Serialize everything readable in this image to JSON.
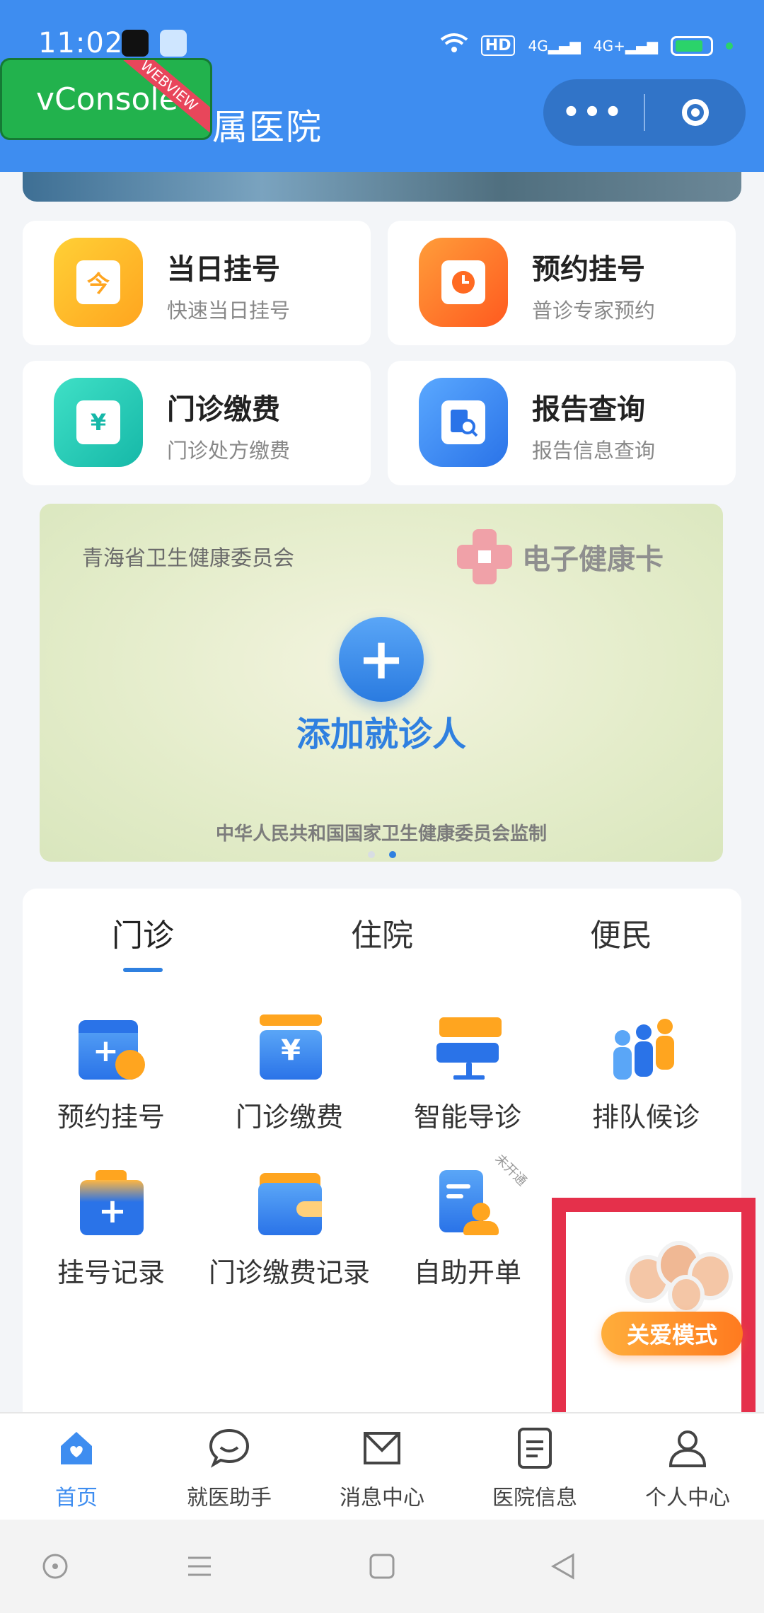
{
  "status_bar": {
    "time": "11:02",
    "net1": "4G",
    "net2": "4G+",
    "hd": "HD"
  },
  "vconsole": {
    "label": "vConsole",
    "ribbon": "WEBVIEW"
  },
  "header": {
    "title": "属医院"
  },
  "quick": [
    {
      "title": "当日挂号",
      "subtitle": "快速当日挂号",
      "icon_text": "今"
    },
    {
      "title": "预约挂号",
      "subtitle": "普诊专家预约"
    },
    {
      "title": "门诊缴费",
      "subtitle": "门诊处方缴费",
      "icon_text": "¥"
    },
    {
      "title": "报告查询",
      "subtitle": "报告信息查询"
    }
  ],
  "health_card": {
    "org": "青海省卫生健康委员会",
    "brand": "电子健康卡",
    "add_label": "添加就诊人",
    "footer": "中华人民共和国国家卫生健康委员会监制"
  },
  "tabs": [
    "门诊",
    "住院",
    "便民"
  ],
  "services": [
    {
      "label": "预约挂号"
    },
    {
      "label": "门诊缴费",
      "icon_text": "¥"
    },
    {
      "label": "智能导诊"
    },
    {
      "label": "排队候诊"
    },
    {
      "label": "挂号记录"
    },
    {
      "label": "门诊缴费记录"
    },
    {
      "label": "自助开单",
      "badge": "未开通"
    }
  ],
  "care_mode": {
    "label": "关爱模式"
  },
  "bottom_nav": [
    "首页",
    "就医助手",
    "消息中心",
    "医院信息",
    "个人中心"
  ],
  "colors": {
    "primary": "#3e8df0",
    "accent": "#2f80e0",
    "highlight_box": "#e5304b"
  }
}
